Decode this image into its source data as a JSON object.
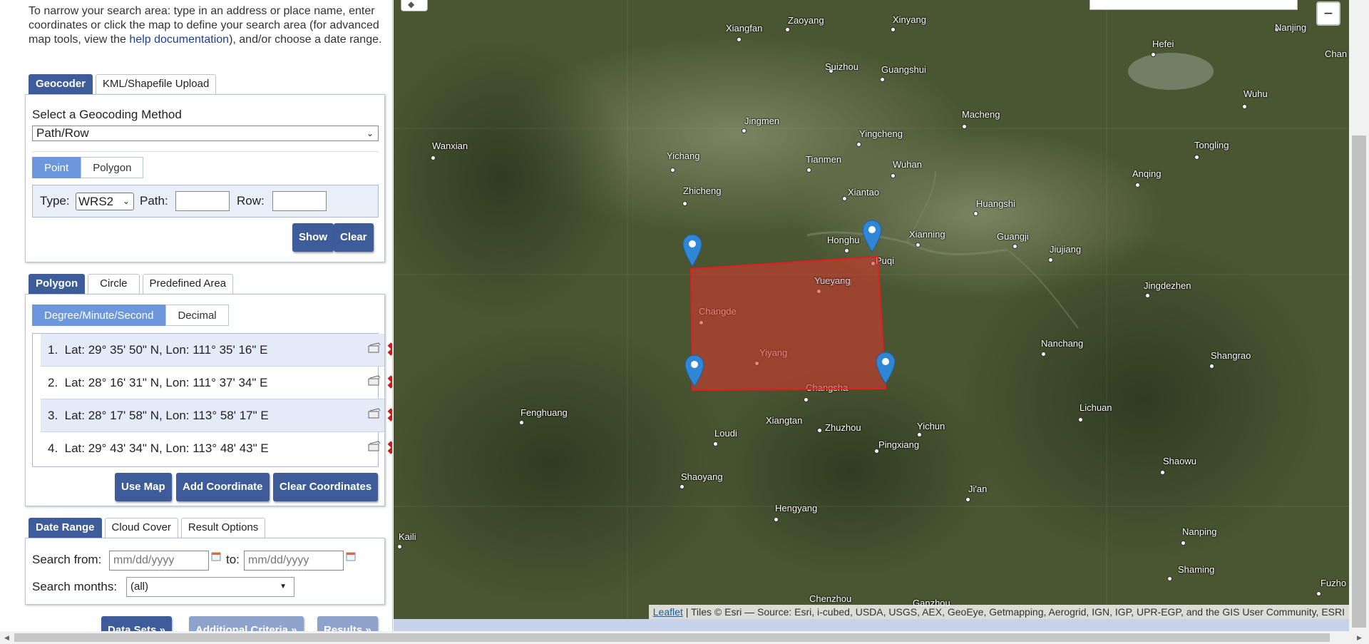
{
  "intro": {
    "text_before_link": "To narrow your search area: type in an address or place name, enter coordinates or click the map to define your search area (for advanced map tools, view the ",
    "link": "help documentation",
    "text_after_link": "), and/or choose a date range."
  },
  "geocoder_tabs": [
    "Geocoder",
    "KML/Shapefile Upload"
  ],
  "geocoder": {
    "method_label": "Select a Geocoding Method",
    "method_value": "Path/Row",
    "shape_tabs": [
      "Point",
      "Polygon"
    ],
    "type_label": "Type:",
    "type_value": "WRS2",
    "path_label": "Path:",
    "row_label": "Row:",
    "show_button": "Show",
    "clear_button": "Clear"
  },
  "area_tabs": [
    "Polygon",
    "Circle",
    "Predefined Area"
  ],
  "coordinates": {
    "format_tabs": [
      "Degree/Minute/Second",
      "Decimal"
    ],
    "rows": [
      {
        "index": "1.",
        "text": "Lat: 29° 35' 50\" N, Lon: 111° 35' 16\" E"
      },
      {
        "index": "2.",
        "text": "Lat: 28° 16' 31\" N, Lon: 111° 37' 34\" E"
      },
      {
        "index": "3.",
        "text": "Lat: 28° 17' 58\" N, Lon: 113° 58' 17\" E"
      },
      {
        "index": "4.",
        "text": "Lat: 29° 43' 34\" N, Lon: 113° 48' 43\" E"
      }
    ],
    "use_map_button": "Use Map",
    "add_coordinate_button": "Add Coordinate",
    "clear_coordinates_button": "Clear Coordinates"
  },
  "date_tabs": [
    "Date Range",
    "Cloud Cover",
    "Result Options"
  ],
  "date_range": {
    "from_label": "Search from:",
    "from_placeholder": "mm/dd/yyyy",
    "to_label": "to:",
    "to_placeholder": "mm/dd/yyyy",
    "months_label": "Search months:",
    "months_value": "(all)"
  },
  "nav_buttons": [
    "Data Sets »",
    "Additional Criteria »",
    "Results »"
  ],
  "map": {
    "zoom_out": "−",
    "cities": [
      "Xiangfan",
      "Zaoyang",
      "Xinyang",
      "Suizhou",
      "Guangshui",
      "Hefei",
      "Nanjing",
      "Chan",
      "Jingmen",
      "Macheng",
      "Wuhu",
      "Wanxian",
      "Yichang",
      "Yingcheng",
      "Tianmen",
      "Wuhan",
      "Tongling",
      "Anqing",
      "Zhicheng",
      "Xiantao",
      "Huangshi",
      "Honghu",
      "Xianning",
      "Guangji",
      "Jiujiang",
      "Puqi",
      "Yueyang",
      "Jingdezhen",
      "Changde",
      "Yiyang",
      "Nanchang",
      "Shangrao",
      "Changsha",
      "Fenghuang",
      "Xiangtan",
      "Zhuzhou",
      "Yichun",
      "Lichuan",
      "Loudi",
      "Pingxiang",
      "Shaowu",
      "Shaoyang",
      "Ji'an",
      "Hengyang",
      "Kaili",
      "Nanping",
      "Shaming",
      "Fuzho",
      "Chenzhou",
      "Ganzhou"
    ],
    "attribution_link": "Leaflet",
    "attribution_text": " | Tiles © Esri — Source: Esri, i-cubed, USDA, USGS, AEX, GeoEye, Getmapping, Aerogrid, IGN, IGP, UPR-EGP, and the GIS User Community, ESRI"
  },
  "colors": {
    "tab_active": "#3d5c99",
    "segment_active": "#6d97dc",
    "polygon_fill": "#d23b2e",
    "marker": "#2f86d4",
    "delete": "#cc1b1b"
  }
}
